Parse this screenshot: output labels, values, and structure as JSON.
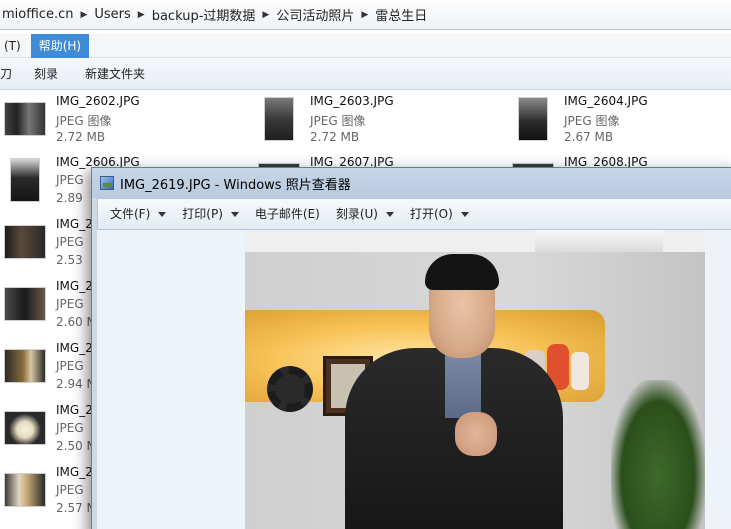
{
  "explorer": {
    "breadcrumb": [
      "mioffice.cn",
      "Users",
      "backup-过期数据",
      "公司活动照片",
      "雷总生日"
    ],
    "menu": [
      "(T)",
      "帮助(H)"
    ],
    "commands": [
      "刀",
      "刻录",
      "新建文件夹"
    ],
    "files": [
      {
        "name": "IMG_2602.JPG",
        "type": "JPEG 图像",
        "size": "2.72 MB"
      },
      {
        "name": "IMG_2603.JPG",
        "type": "JPEG 图像",
        "size": "2.72 MB"
      },
      {
        "name": "IMG_2604.JPG",
        "type": "JPEG 图像",
        "size": "2.67 MB"
      },
      {
        "name": "IMG_2606.JPG",
        "type": "JPEG",
        "size": "2.89"
      },
      {
        "name": "IMG_2607.JPG",
        "type": "",
        "size": ""
      },
      {
        "name": "IMG_2608.JPG",
        "type": "",
        "size": ""
      },
      {
        "name": "IMG_2",
        "type": "JPEG",
        "size": "2.53"
      },
      {
        "name": "IMG_2",
        "type": "JPEG",
        "size": "2.60 N"
      },
      {
        "name": "IMG_2",
        "type": "JPEG",
        "size": "2.94 N"
      },
      {
        "name": "IMG_2",
        "type": "JPEG",
        "size": "2.50 N"
      },
      {
        "name": "IMG_2",
        "type": "JPEG",
        "size": "2.57 N"
      }
    ]
  },
  "viewer": {
    "title": "IMG_2619.JPG - Windows 照片查看器",
    "menu": [
      "文件(F)",
      "打印(P)",
      "电子邮件(E)",
      "刻录(U)",
      "打开(O)"
    ]
  },
  "colors": {
    "menu_active": "#3e8bd8",
    "viewer_chrome": "#c7d6e8"
  }
}
